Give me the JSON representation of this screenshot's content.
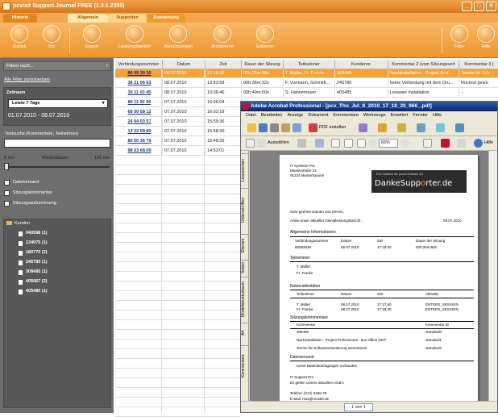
{
  "window": {
    "title": "pcvisit Support.Journal FREE (1.3.1.2355)",
    "controls": [
      "_",
      "□",
      "✕"
    ]
  },
  "ribbon": {
    "tabs": [
      "Historie",
      "Allgemein",
      "Supporten",
      "Auswertung"
    ],
    "buttons": [
      "Zurück",
      "Vor",
      "Export",
      "Leistungsbericht",
      "Abrechnungen",
      "Archivieren",
      "Editieren",
      "Filter",
      "Hilfe"
    ]
  },
  "filter": {
    "header": "Filtern nach...",
    "collapse_icon": "‹",
    "reset": "Alle Filter zurücksetzen",
    "zeitraum_label": "Zeitraum",
    "period": "Letzte 7 Tage",
    "date_range": "01.07.2010 - 08.07.2010",
    "textsuche_label": "Textsuche (Kommentare, Teilnehmer)",
    "textsuche_value": "",
    "min_label": "0 min",
    "mindestdauer_label": "Mindestdauer",
    "max_label": "165 min",
    "slider_value_min": 0,
    "checkboxes": [
      "Dateiversand",
      "Sitzungskommentar",
      "Sitzungsaufzeichnung"
    ],
    "kunden_label": "Kunden",
    "kunden": [
      "040598 (1)",
      "134075 (1)",
      "180770 (2)",
      "246780 (1)",
      "308495 (1)",
      "405067 (2)",
      "405485 (1)"
    ]
  },
  "grid": {
    "columns": [
      "Verbindungsnummer",
      "Datum",
      "Zeit",
      "Dauer der Sitzung",
      "Teilnehmer",
      "Kundennr.",
      "Kommentar 2 (vom Sitzungsverl",
      "Kommentar 3 ("
    ],
    "rows": [
      {
        "id": "80 09 30 30",
        "date": "08.07.2010",
        "time": "17:18:20",
        "duration": "00h:26m:58s",
        "participants": "T. Müller, Fr. Franke",
        "customer": "308495",
        "comment2": "Nachinstallation - Project Prof...",
        "comment3": "Termin für Sch",
        "selected": true
      },
      {
        "id": "38 21 06 63",
        "date": "08.07.2010",
        "time": "13:53:58",
        "duration": "00h:36m:32s",
        "participants": "F. Vormann, Schmidt...",
        "customer": "246780",
        "comment2": "keine Verbindung mit dem Dru...",
        "comment3": "Rückruf gewü",
        "selected": false
      },
      {
        "id": "35 11 03 45",
        "date": "08.07.2010",
        "time": "10:36:46",
        "duration": "00h:40m:00s",
        "participants": "S. Hahnemeyer",
        "customer": "405485",
        "comment2": "Lexware Installation",
        "comment3": "-",
        "selected": false
      },
      {
        "id": "80 11 92 56",
        "date": "07.07.2010",
        "time": "16:06:04",
        "selected": false
      },
      {
        "id": "68 00 58 12",
        "date": "07.07.2010",
        "time": "16:03:18",
        "selected": false
      },
      {
        "id": "24 44 03 57",
        "date": "07.07.2010",
        "time": "15:59:36",
        "selected": false
      },
      {
        "id": "13 22 58 80",
        "date": "07.07.2010",
        "time": "15:58:30",
        "selected": false
      },
      {
        "id": "80 00 36 79",
        "date": "07.07.2010",
        "time": "15:48:35",
        "selected": false
      },
      {
        "id": "98 23 68 09",
        "date": "07.07.2010",
        "time": "14:53:01",
        "selected": false
      }
    ]
  },
  "acrobat": {
    "title": "Adobe Acrobat Professional - [pcv_Thu_Jul_8_2010_17_18_20_966_.pdf]",
    "menu": [
      "Datei",
      "Bearbeiten",
      "Anzeige",
      "Dokument",
      "Kommentare",
      "Werkzeuge",
      "Erweitert",
      "Fenster",
      "Hilfe"
    ],
    "pdf_create": "PDF erstellen",
    "select_tool": "Auswählen",
    "zoom": "65%",
    "help_btn": "Hilfe",
    "side_tabs": [
      "Lesezeichen",
      "Unterschriften",
      "Ebenen",
      "Seiten",
      "Modellstrukturbaum",
      "Art",
      "Kommentare"
    ],
    "page_indicator": "1 von 1"
  },
  "pdf": {
    "sender": [
      "IT Systeme Pro",
      "Musterstraße 22",
      "01234 Musterhausen"
    ],
    "logo_small": "Eine Initiative der pcvisit Software AG",
    "logo_main": "DankeSupp",
    "logo_accent": "o",
    "logo_tail": "rter.de",
    "greeting": "Sehr geehrte Damen und Herren,",
    "subject": "Anbei unser aktueller Dienstleistungsbericht :",
    "report_date": "09.07.2010",
    "sec_general": "Allgemeine Informationen",
    "general_headers": [
      "Verbindungsnummer",
      "Datum",
      "Zeit",
      "Dauer der Sitzung"
    ],
    "general_row": [
      "80093030",
      "08.07.2010",
      "17:18:20",
      "00h:26m:58s"
    ],
    "sec_participants": "Teilnehmer",
    "participants": [
      "T. Müller",
      "Fr. Franke"
    ],
    "sec_activities": "Nutzeraktivitäten",
    "activity_headers": [
      "Teilnehmer",
      "Datum",
      "Zeit",
      "Aktivität"
    ],
    "activity_rows": [
      [
        "T. Müller",
        "08.07.2010",
        "17:17:50",
        "ENTERS_SESSION"
      ],
      [
        "Fr. Franke",
        "08.07.2010",
        "17:18:20",
        "ENTERS_SESSION"
      ]
    ],
    "sec_comments": "Sitzungskommentare",
    "comment_headers": [
      "Kommentar",
      "Kommentar ID"
    ],
    "comment_rows": [
      [
        "308495",
        "standard0"
      ],
      [
        "Nachinstallation - Project Professional - aus Office 2007",
        "standard1"
      ],
      [
        "Termin für Softwareerweiterung vereinbaren",
        "standard2"
      ]
    ],
    "sec_files": "Dateiversand",
    "files_none": "Keine Dateiübertragungen vorhanden",
    "closing": [
      "IT Support Pro",
      "Es gelten unsere aktuellen AGB's"
    ],
    "contact": [
      "Telefon: (012) 3456-78",
      "E-Mail: max@muster.de"
    ]
  },
  "colors": {
    "accent": "#f29b2e",
    "panel": "#6e6e6e",
    "selected_row": "#f7a233",
    "acrobat_title": "#0a246a"
  }
}
